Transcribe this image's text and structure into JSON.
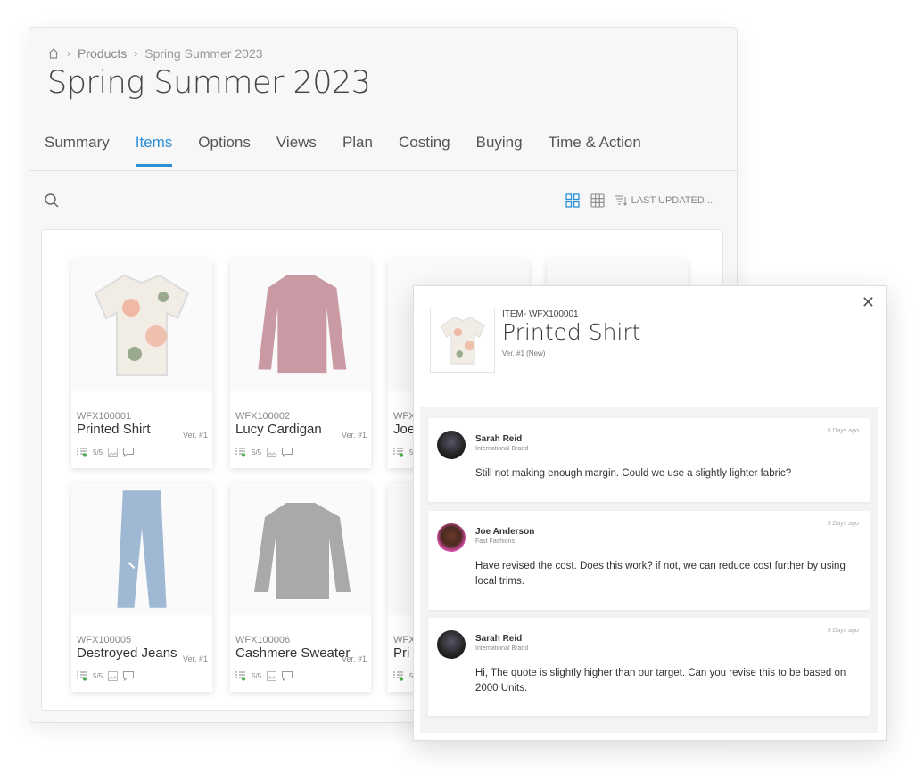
{
  "breadcrumb": {
    "home_icon": "home-icon",
    "items": [
      "Products",
      "Spring Summer 2023"
    ]
  },
  "page": {
    "title": "Spring Summer 2023"
  },
  "tabs": [
    {
      "label": "Summary"
    },
    {
      "label": "Items",
      "active": true
    },
    {
      "label": "Options"
    },
    {
      "label": "Views"
    },
    {
      "label": "Plan"
    },
    {
      "label": "Costing"
    },
    {
      "label": "Buying"
    },
    {
      "label": "Time & Action"
    }
  ],
  "toolbar": {
    "sort_label": "LAST UPDATED ...",
    "accent": "#2b8fd6"
  },
  "items": [
    {
      "code": "WFX100001",
      "ver": "Ver. #1",
      "name": "Printed Shirt",
      "progress": "5/5"
    },
    {
      "code": "WFX100002",
      "ver": "Ver. #1",
      "name": "Lucy Cardigan",
      "progress": "5/5"
    },
    {
      "code": "WFX",
      "ver": "",
      "name": "Joe",
      "progress": "5/"
    },
    {
      "code": "",
      "ver": "",
      "name": "",
      "progress": ""
    },
    {
      "code": "WFX100005",
      "ver": "Ver. #1",
      "name": "Destroyed Jeans",
      "progress": "5/5"
    },
    {
      "code": "WFX100006",
      "ver": "Ver. #1",
      "name": "Cashmere Sweater",
      "progress": "5/5"
    },
    {
      "code": "WFX",
      "ver": "",
      "name": "Pri",
      "progress": "5/"
    }
  ],
  "modal": {
    "code": "ITEM- WFX100001",
    "name": "Printed Shirt",
    "version": "Ver. #1 (New)",
    "comments": [
      {
        "author": "Sarah Reid",
        "org": "International Brand",
        "time": "5 Days ago",
        "text": "Still not making enough margin. Could we use a slightly lighter fabric?"
      },
      {
        "author": "Joe Anderson",
        "org": "Fast Fashions",
        "time": "5 Days ago",
        "text": "Have revised the cost. Does this work? if not, we can reduce cost further by using local trims."
      },
      {
        "author": "Sarah Reid",
        "org": "International Brand",
        "time": "5 Days ago",
        "text": "Hi, The quote is slightly higher than our target. Can you revise this to be based on 2000 Units."
      }
    ]
  }
}
